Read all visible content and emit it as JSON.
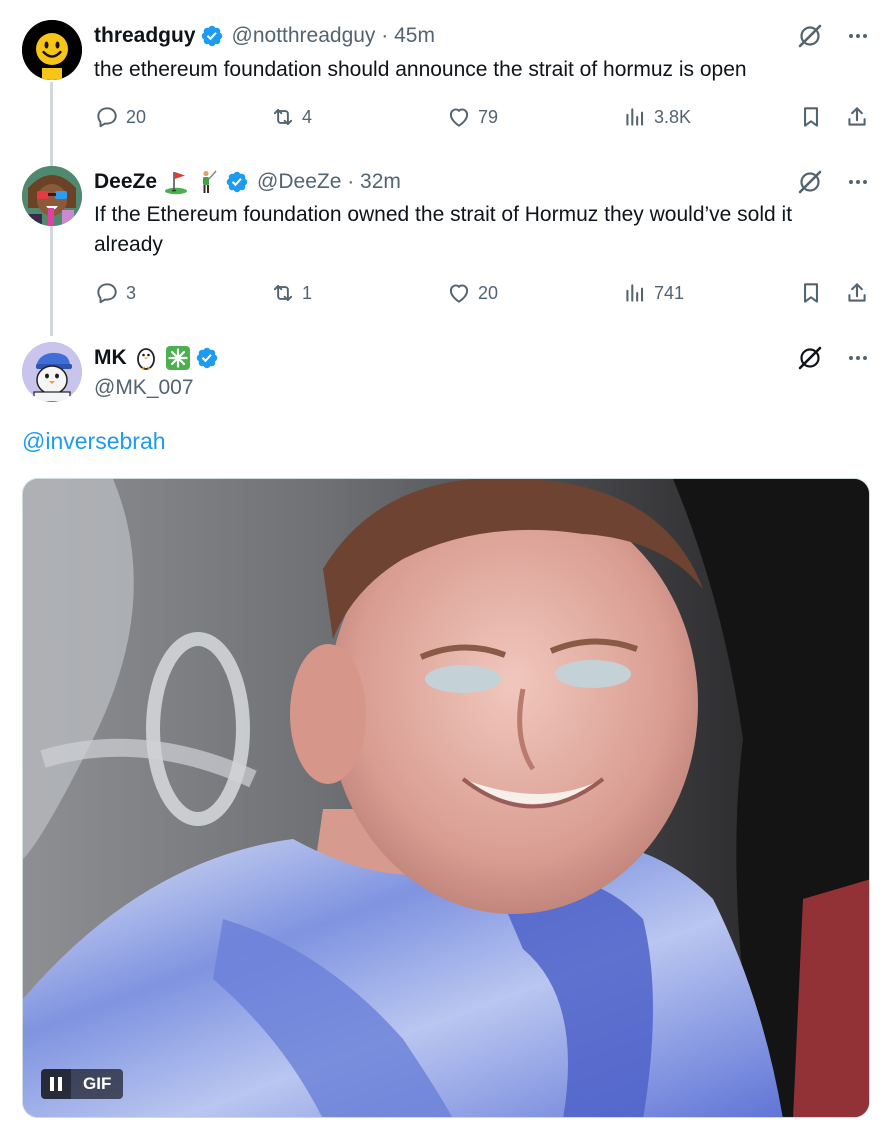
{
  "colors": {
    "accent": "#1d9bf0",
    "text_primary": "#0f1419",
    "text_secondary": "#536471",
    "thread_line": "#cfd9de"
  },
  "tweets": [
    {
      "avatar_icon": "smiley-avatar",
      "name": "threadguy",
      "verified": true,
      "handle_time": "@notthreadguy · 45m",
      "text": "the ethereum foundation should announce the strait of hormuz is open",
      "stats": {
        "replies": "20",
        "reposts": "4",
        "likes": "79",
        "views": "3.8K"
      }
    },
    {
      "avatar_icon": "cartoon-avatar",
      "name": "DeeZe",
      "name_emojis": [
        "golf-flag-icon",
        "golfer-icon"
      ],
      "verified": true,
      "handle_time": "@DeeZe · 32m",
      "text": "If the Ethereum foundation owned the strait of Hormuz they would’ve sold it already",
      "stats": {
        "replies": "3",
        "reposts": "1",
        "likes": "20",
        "views": "741"
      }
    },
    {
      "avatar_icon": "penguin-cap-avatar",
      "name": "MK",
      "name_emojis": [
        "penguin-icon",
        "sparkle-icon"
      ],
      "verified": true,
      "handle": "@MK_007",
      "mention": "@inversebrah",
      "media": {
        "type": "gif",
        "badge": "GIF",
        "description_icon": "gif-image"
      }
    }
  ]
}
